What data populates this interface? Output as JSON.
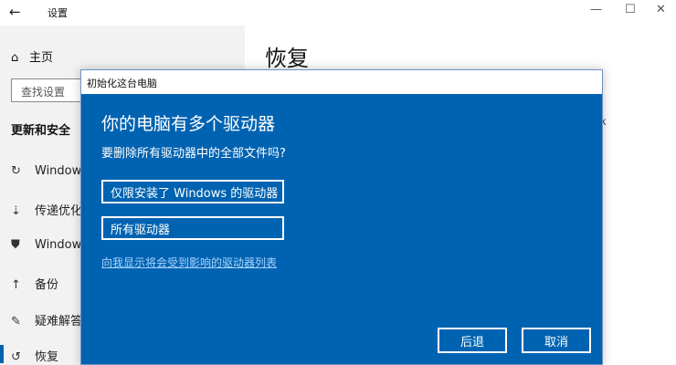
{
  "window": {
    "title": "设置",
    "back_icon": "back-arrow-icon",
    "controls": {
      "minimize": "—",
      "maximize": "☐",
      "close": "✕"
    }
  },
  "sidebar": {
    "home": {
      "label": "主页",
      "icon": "home-icon"
    },
    "search_placeholder": "查找设置",
    "section_title": "更新和安全",
    "items": [
      {
        "label": "Windows",
        "icon": "refresh-icon"
      },
      {
        "label": "传递优化",
        "icon": "delivery-icon"
      },
      {
        "label": "Windows",
        "icon": "shield-icon"
      },
      {
        "label": "备份",
        "icon": "backup-icon"
      },
      {
        "label": "疑难解答",
        "icon": "wrench-icon"
      },
      {
        "label": "恢复",
        "icon": "recovery-icon"
      }
    ]
  },
  "main": {
    "title": "恢复"
  },
  "dialog": {
    "title": "初始化这台电脑",
    "heading": "你的电脑有多个驱动器",
    "question": "要删除所有驱动器中的全部文件吗?",
    "options": [
      "仅限安装了 Windows 的驱动器",
      "所有驱动器"
    ],
    "link": "向我显示将会受到影响的驱动器列表",
    "back_label": "后退",
    "cancel_label": "取消"
  },
  "colors": {
    "dialog_blue": "#0063b1",
    "sidebar_bg": "#f2f2f2",
    "link": "#a8d4ff"
  }
}
